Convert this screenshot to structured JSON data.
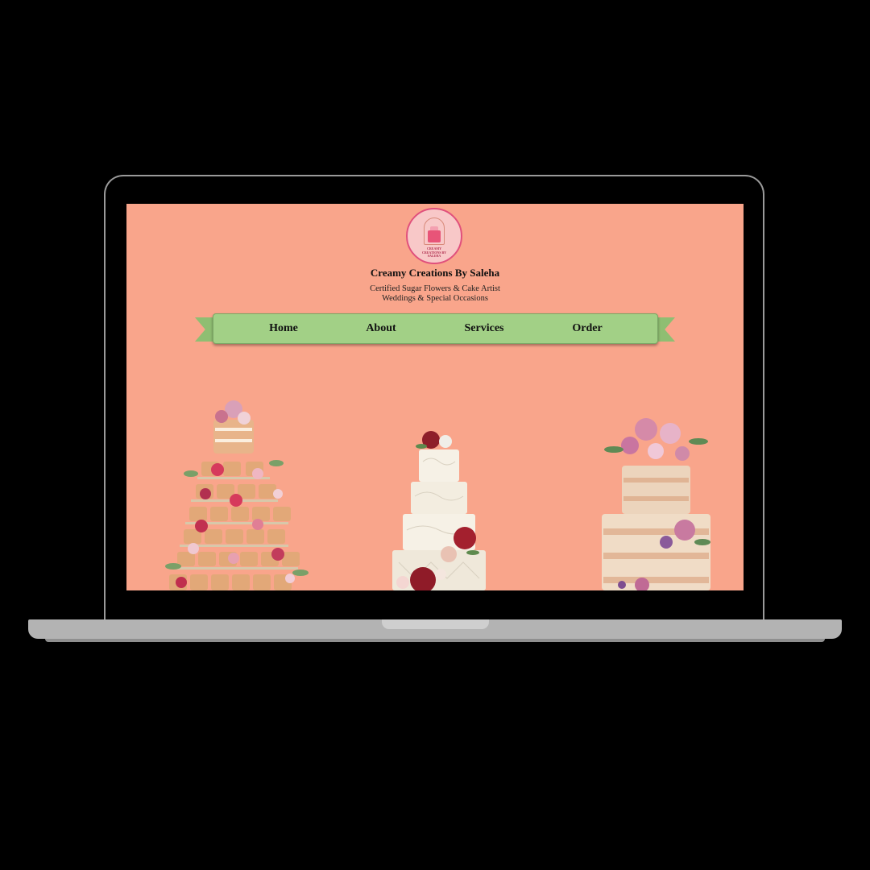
{
  "site": {
    "title": "Creamy Creations By Saleha",
    "tagline_line1": "Certified Sugar Flowers & Cake Artist",
    "tagline_line2": "Weddings & Special Occasions",
    "logo_text_line1": "CREAMY",
    "logo_text_line2": "CREATIONS BY",
    "logo_text_line3": "SALEHA"
  },
  "nav": {
    "items": [
      {
        "label": "Home"
      },
      {
        "label": "About"
      },
      {
        "label": "Services"
      },
      {
        "label": "Order"
      }
    ]
  },
  "gallery": {
    "images": [
      {
        "name": "naked mini cake tower with roses",
        "icon": "cake-tower-image"
      },
      {
        "name": "white tiered wedding cake with red flowers",
        "icon": "white-cake-image"
      },
      {
        "name": "semi-naked tiered cake with pink roses",
        "icon": "naked-cake-image"
      }
    ]
  },
  "colors": {
    "background": "#f9a58b",
    "ribbon": "#a2d086",
    "logo_ring": "#e0507c"
  }
}
